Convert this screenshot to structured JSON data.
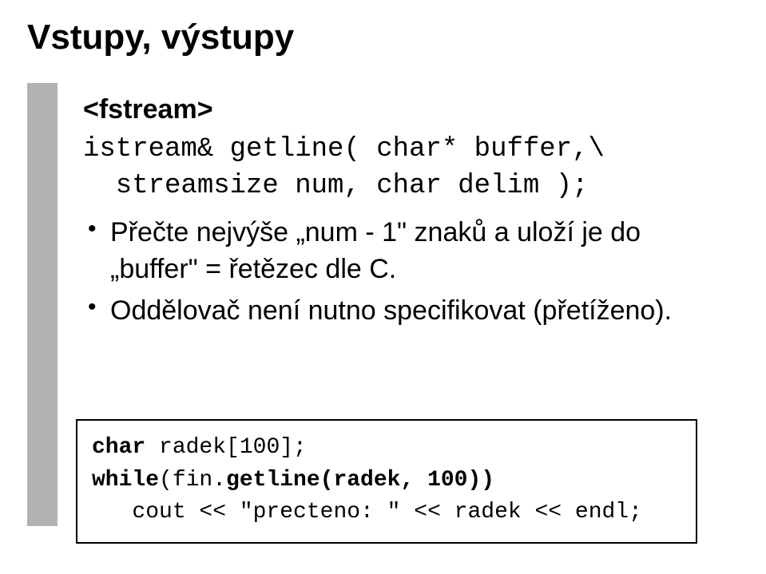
{
  "slide": {
    "title": "Vstupy, výstupy",
    "subheading": "<fstream>",
    "signature": {
      "line1": "istream& getline( char* buffer,\\",
      "line2": "  streamsize num, char delim );"
    },
    "bullets": [
      "Přečte nejvýše „num - 1\" znaků a uloží je do „buffer\" = řetězec dle C.",
      "Oddělovač není nutno specifikovat (přetíženo)."
    ],
    "code": {
      "line1_type": "char",
      "line1_rest": " radek[100];",
      "line2_kw": "while",
      "line2_rest": "(fin.",
      "line2_call": "getline(radek, 100))",
      "line3": "   cout << \"precteno: \" << radek << endl;"
    }
  }
}
